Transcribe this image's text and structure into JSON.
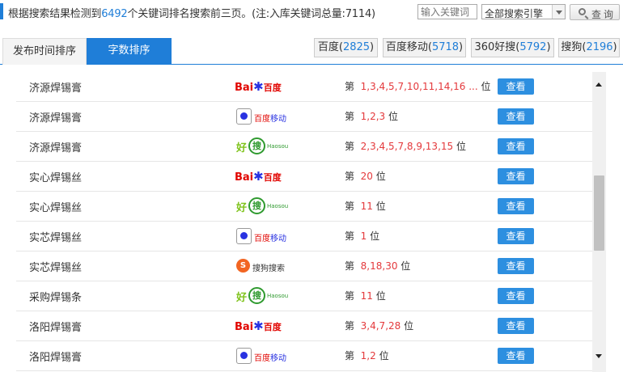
{
  "summary": {
    "prefix": "根据搜索结果检测到",
    "count": "6492",
    "suffix": "个关键词排名搜索前三页。(注:入库关键词总量:7114)"
  },
  "search": {
    "placeholder": "输入关键词",
    "engine_selected": "全部搜索引擎",
    "query_label": "查询"
  },
  "sort_tabs": [
    {
      "label": "发布时间排序",
      "active": false
    },
    {
      "label": "字数排序",
      "active": true
    }
  ],
  "engine_tabs": [
    {
      "name": "百度",
      "count": "2825"
    },
    {
      "name": "百度移动",
      "count": "5718"
    },
    {
      "name": "360好搜",
      "count": "5792"
    },
    {
      "name": "搜狗",
      "count": "2196"
    }
  ],
  "rows": [
    {
      "keyword": "济源焊锡膏",
      "engine": "baidu",
      "rank_prefix": "第",
      "ranks": "1,3,4,5,7,10,11,14,16 ...",
      "rank_suffix": "位",
      "action": "查看"
    },
    {
      "keyword": "济源焊锡膏",
      "engine": "baidu-mobile",
      "rank_prefix": "第",
      "ranks": "1,2,3",
      "rank_suffix": "位",
      "action": "查看"
    },
    {
      "keyword": "济源焊锡膏",
      "engine": "haosou",
      "rank_prefix": "第",
      "ranks": "2,3,4,5,7,8,9,13,15",
      "rank_suffix": "位",
      "action": "查看"
    },
    {
      "keyword": "实心焊锡丝",
      "engine": "baidu",
      "rank_prefix": "第",
      "ranks": "20",
      "rank_suffix": "位",
      "action": "查看"
    },
    {
      "keyword": "实心焊锡丝",
      "engine": "haosou",
      "rank_prefix": "第",
      "ranks": "11",
      "rank_suffix": "位",
      "action": "查看"
    },
    {
      "keyword": "实芯焊锡丝",
      "engine": "baidu-mobile",
      "rank_prefix": "第",
      "ranks": "1",
      "rank_suffix": "位",
      "action": "查看"
    },
    {
      "keyword": "实芯焊锡丝",
      "engine": "sogou",
      "rank_prefix": "第",
      "ranks": "8,18,30",
      "rank_suffix": "位",
      "action": "查看"
    },
    {
      "keyword": "采购焊锡条",
      "engine": "haosou",
      "rank_prefix": "第",
      "ranks": "11",
      "rank_suffix": "位",
      "action": "查看"
    },
    {
      "keyword": "洛阳焊锡膏",
      "engine": "baidu",
      "rank_prefix": "第",
      "ranks": "3,4,7,28",
      "rank_suffix": "位",
      "action": "查看"
    },
    {
      "keyword": "洛阳焊锡膏",
      "engine": "baidu-mobile",
      "rank_prefix": "第",
      "ranks": "1,2",
      "rank_suffix": "位",
      "action": "查看"
    }
  ],
  "logos": {
    "baidu": {
      "en": "Bai",
      "cn": "百度"
    },
    "baidu-mobile": {
      "cn1": "百度",
      "cn2": "移动"
    },
    "haosou": {
      "hao": "好",
      "sou": "搜",
      "en": "Haosou"
    },
    "sogou": {
      "mark": "S",
      "cn": "搜狗搜索"
    }
  },
  "scroll": {
    "position": 0.45,
    "visible_fraction": 0.3
  },
  "colors": {
    "accent": "#1f7ed8",
    "rank_numbers": "#e4393c",
    "view_button": "#2d8fe0"
  }
}
